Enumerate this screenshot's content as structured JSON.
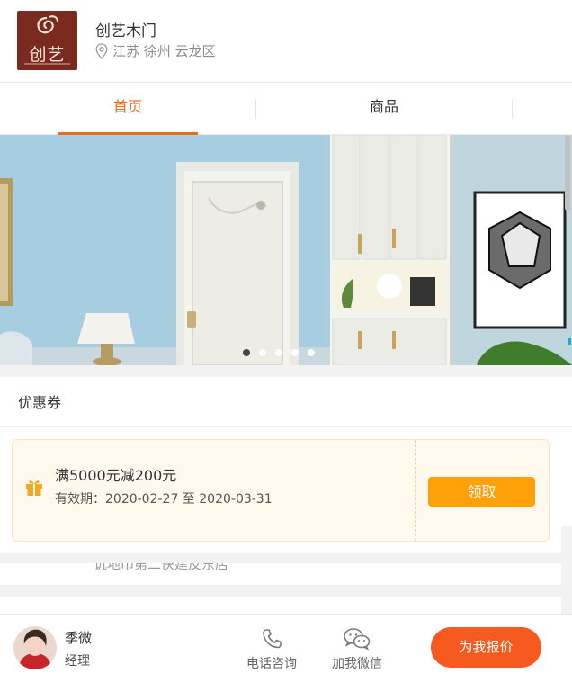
{
  "shop": {
    "name": "创艺木门",
    "location": "江苏 徐州 云龙区",
    "logo_text": "创艺"
  },
  "tabs": [
    {
      "label": "首页",
      "active": true
    },
    {
      "label": "商品",
      "active": false
    }
  ],
  "banner": {
    "slide_count": 5,
    "active_slide": 1
  },
  "coupon_section": {
    "title": "优惠券",
    "coupon": {
      "amount_text": "满5000元减200元",
      "validity": "有效期：2020-02-27 至 2020-03-31",
      "claim_label": "领取"
    }
  },
  "obscured_text": "讥地巾第二快建反东店",
  "agent": {
    "name": "季微",
    "role": "经理"
  },
  "actions": {
    "phone_label": "电话咨询",
    "wechat_label": "加我微信",
    "quote_label": "为我报价"
  },
  "colors": {
    "accent": "#f26b1d",
    "claim": "#fea008",
    "quote": "#f65a1f",
    "logo_bg": "#7a2a1e"
  }
}
